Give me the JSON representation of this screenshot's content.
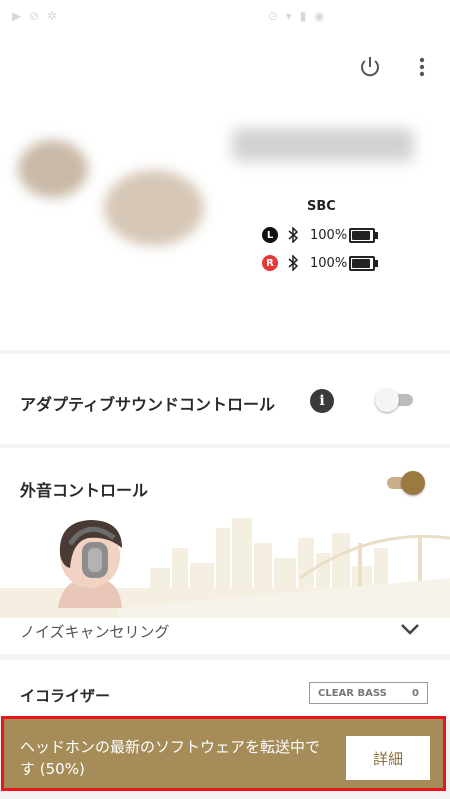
{
  "status_bar": {
    "left_icons": "▶ ⊘ ✲",
    "right_icons": "⊙ ▾ ▮ ◉"
  },
  "device": {
    "codec": "SBC",
    "left": {
      "badge": "L",
      "battery_text": "100%",
      "battery_level": 1.0
    },
    "right": {
      "badge": "R",
      "battery_text": "100%",
      "battery_level": 1.0
    }
  },
  "header_icons": [
    "power-icon",
    "more-vert-icon"
  ],
  "adaptive_sound": {
    "label": "アダプティブサウンドコントロール",
    "info_glyph": "i",
    "enabled": false
  },
  "ambient": {
    "label": "外音コントロール",
    "enabled": true,
    "mode_label": "ノイズキャンセリング"
  },
  "equalizer": {
    "label": "イコライザー",
    "badge_label": "CLEAR BASS",
    "badge_value": "0"
  },
  "banner": {
    "message": "ヘッドホンの最新のソフトウェアを転送中です (50%)",
    "button_label": "詳細",
    "progress_percent": 50
  },
  "colors": {
    "accent": "#9a7a3f",
    "banner_bg": "#a58c58",
    "highlight_border": "#e8161a",
    "right_badge": "#e53935"
  }
}
